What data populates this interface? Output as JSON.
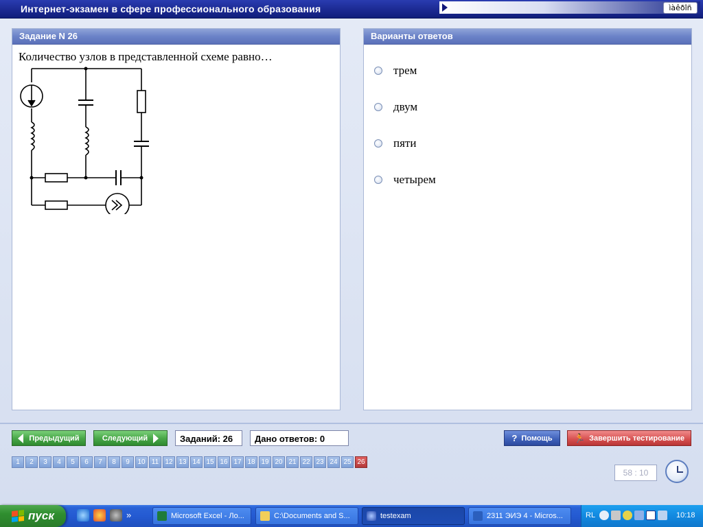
{
  "window": {
    "title": "Интернет-экзамен в сфере профессионального образования",
    "lang_indicator": "ìàêðîñ"
  },
  "task_panel": {
    "header": "Задание N 26",
    "question": "Количество узлов в представленной схеме равно…"
  },
  "answers_panel": {
    "header": "Варианты ответов",
    "options": [
      "трем",
      "двум",
      "пяти",
      "четырем"
    ]
  },
  "nav": {
    "prev_label": "Предыдущий",
    "next_label": "Следующий",
    "tasks_counter": "Заданий: 26",
    "answers_counter": "Дано ответов: 0",
    "help_label": "Помощь",
    "finish_label": "Завершить тестирование"
  },
  "pager": {
    "pages": [
      "1",
      "2",
      "3",
      "4",
      "5",
      "6",
      "7",
      "8",
      "9",
      "10",
      "11",
      "12",
      "13",
      "14",
      "15",
      "16",
      "17",
      "18",
      "19",
      "20",
      "21",
      "22",
      "23",
      "24",
      "25",
      "26"
    ],
    "active": "26"
  },
  "timer": "58 : 10",
  "taskbar": {
    "start_label": "пуск",
    "ql_more": "»",
    "items": [
      {
        "label": "Microsoft Excel - Ло...",
        "icon": "excel-icon"
      },
      {
        "label": "C:\\Documents and S...",
        "icon": "folder-icon"
      },
      {
        "label": "testexam",
        "icon": "testexam-icon"
      },
      {
        "label": "2311 ЭИЭ 4 - Micros...",
        "icon": "word-icon"
      }
    ],
    "tray_lang": "RL",
    "clock": "10:18"
  },
  "colors": {
    "title_bar": "#1a2890",
    "panel_header": "#6b82c8",
    "nav_green": "#4aa84a",
    "finish_red": "#d54e4e",
    "help_blue": "#3d5fb8",
    "active_page": "#b43a3a"
  }
}
